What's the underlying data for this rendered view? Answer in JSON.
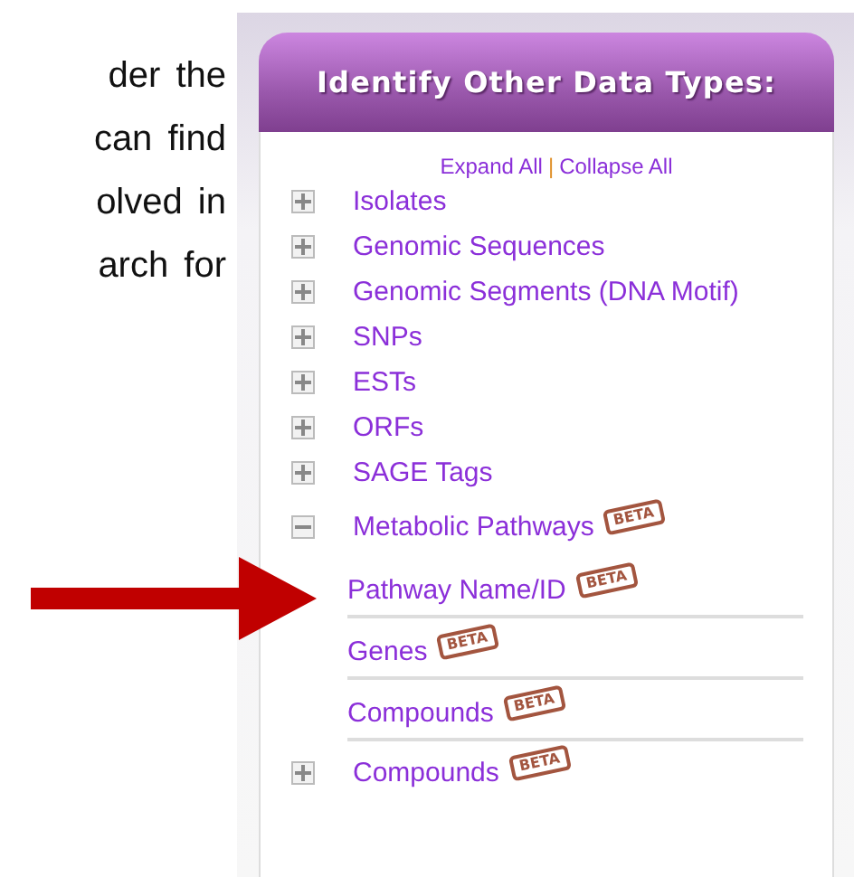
{
  "intro_lines": [
    "der the",
    "can find",
    "olved in",
    "arch for"
  ],
  "panel": {
    "title": "Identify Other Data Types:",
    "expand_all": "Expand All",
    "separator": "|",
    "collapse_all": "Collapse All",
    "items": [
      {
        "label": "Isolates",
        "expanded": false
      },
      {
        "label": "Genomic Sequences",
        "expanded": false
      },
      {
        "label": "Genomic Segments (DNA Motif)",
        "expanded": false
      },
      {
        "label": "SNPs",
        "expanded": false
      },
      {
        "label": "ESTs",
        "expanded": false
      },
      {
        "label": "ORFs",
        "expanded": false
      },
      {
        "label": "SAGE Tags",
        "expanded": false
      },
      {
        "label": "Metabolic Pathways",
        "badge": "BETA",
        "expanded": true,
        "children": [
          {
            "label": "Pathway Name/ID",
            "badge": "BETA"
          },
          {
            "label": "Genes",
            "badge": "BETA"
          },
          {
            "label": "Compounds",
            "badge": "BETA"
          }
        ]
      },
      {
        "label": "Compounds",
        "badge": "BETA",
        "expanded": false
      }
    ]
  }
}
